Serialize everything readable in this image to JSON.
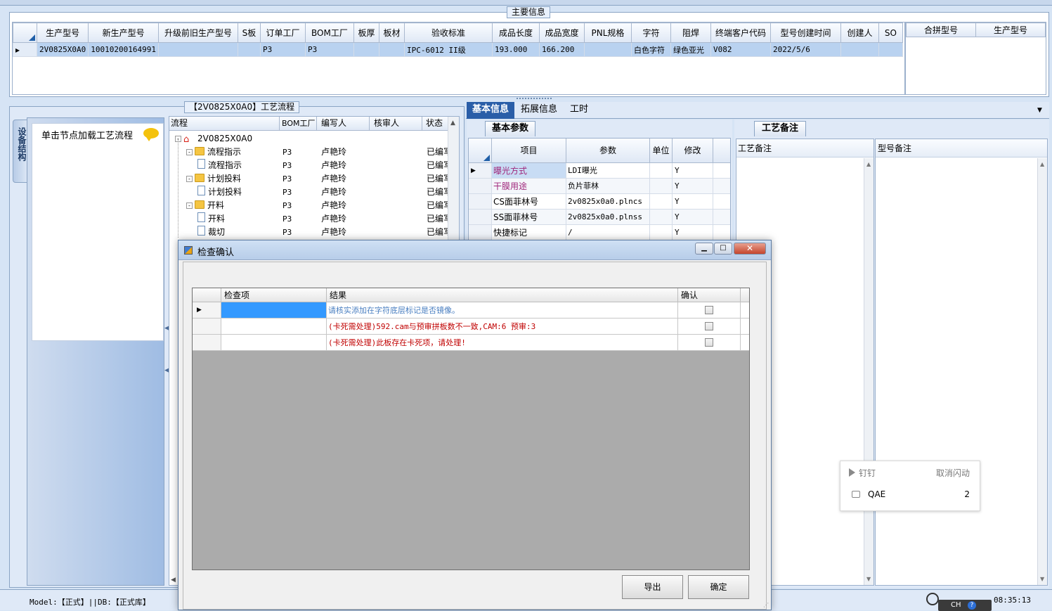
{
  "main_info": {
    "title": "主要信息",
    "columns": [
      "生产型号",
      "新生产型号",
      "升级前旧生产型号",
      "S板",
      "订单工厂",
      "BOM工厂",
      "板厚",
      "板材",
      "验收标准",
      "成品长度",
      "成品宽度",
      "PNL规格",
      "字符",
      "阻焊",
      "终端客户代码",
      "型号创建时间",
      "创建人",
      "SO"
    ],
    "row": [
      "2V0825X0A0",
      "10010200164991",
      "",
      "",
      "P3",
      "P3",
      "",
      "",
      "IPC-6012 II级",
      "193.000",
      "166.200",
      "",
      "白色字符",
      "绿色亚光",
      "V082",
      "2022/5/6",
      "",
      ""
    ],
    "side_columns": [
      "合拼型号",
      "生产型号"
    ]
  },
  "process": {
    "title": "【2V0825X0A0】工艺流程",
    "side_tab": "设备结构",
    "hint_text": "单击节点加载工艺流程",
    "columns": [
      "流程",
      "BOM工厂",
      "编写人",
      "核审人",
      "状态"
    ],
    "tree": [
      {
        "label": "2V0825X0A0",
        "bom": "",
        "writer": "",
        "reviewer": "",
        "status": "",
        "icon": "home-icon"
      },
      {
        "label": "流程指示",
        "bom": "P3",
        "writer": "卢艳玲",
        "reviewer": "",
        "status": "已编写",
        "icon": "folder-icon"
      },
      {
        "label": "流程指示",
        "bom": "P3",
        "writer": "卢艳玲",
        "reviewer": "",
        "status": "已编写",
        "icon": "document-icon"
      },
      {
        "label": "计划投料",
        "bom": "P3",
        "writer": "卢艳玲",
        "reviewer": "",
        "status": "已编写",
        "icon": "folder-icon"
      },
      {
        "label": "计划投料",
        "bom": "P3",
        "writer": "卢艳玲",
        "reviewer": "",
        "status": "已编写",
        "icon": "document-icon"
      },
      {
        "label": "开料",
        "bom": "P3",
        "writer": "卢艳玲",
        "reviewer": "",
        "status": "已编写",
        "icon": "folder-icon"
      },
      {
        "label": "开料",
        "bom": "P3",
        "writer": "卢艳玲",
        "reviewer": "",
        "status": "已编写",
        "icon": "document-icon"
      },
      {
        "label": "裁切",
        "bom": "P3",
        "writer": "卢艳玲",
        "reviewer": "",
        "status": "已编写",
        "icon": "document-icon"
      }
    ]
  },
  "right_tabs": [
    "基本信息",
    "拓展信息",
    "工时"
  ],
  "basic_params": {
    "tab": "基本参数",
    "columns": [
      "项目",
      "参数",
      "单位",
      "修改"
    ],
    "rows": [
      {
        "item": "曝光方式",
        "param": "LDI曝光",
        "unit": "",
        "modify": "Y"
      },
      {
        "item": "干膜用途",
        "param": "负片菲林",
        "unit": "",
        "modify": "Y"
      },
      {
        "item": "CS面菲林号",
        "param": "2v0825x0a0.plncs",
        "unit": "",
        "modify": "Y"
      },
      {
        "item": "SS面菲林号",
        "param": "2v0825x0a0.plnss",
        "unit": "",
        "modify": "Y"
      },
      {
        "item": "快捷标记",
        "param": "/",
        "unit": "",
        "modify": "Y"
      }
    ]
  },
  "remarks": {
    "tab": "工艺备注",
    "columns": [
      "工艺备注",
      "型号备注"
    ]
  },
  "dialog": {
    "title": "检查确认",
    "columns": [
      "检查项",
      "结果",
      "确认"
    ],
    "rows": [
      {
        "item": "",
        "result": "请核实添加在字符底层标记是否镜像。",
        "color": "#4a7fc1"
      },
      {
        "item": "",
        "result": "(卡死需处理)592.cam与预审拼板数不一致,CAM:6 预审:3",
        "color": "#c00000"
      },
      {
        "item": "",
        "result": "(卡死需处理)此板存在卡死项，请处理!",
        "color": "#c00000"
      }
    ],
    "export_label": "导出",
    "ok_label": "确定"
  },
  "notification": {
    "app": "钉钉",
    "cancel": "取消闪动",
    "item": "QAE",
    "count": "2"
  },
  "status": {
    "left": "Model:【正式】||DB:【正式库】",
    "time": "08:35:13",
    "ime": "CH"
  }
}
